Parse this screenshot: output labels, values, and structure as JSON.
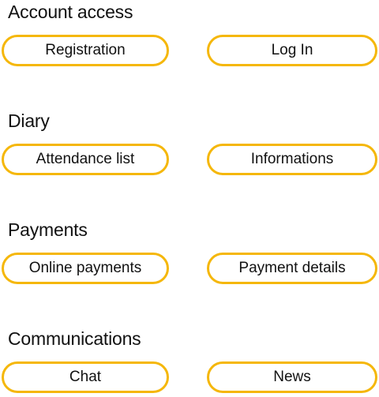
{
  "sections": [
    {
      "title": "Account access",
      "buttons": [
        "Registration",
        "Log In"
      ]
    },
    {
      "title": "Diary",
      "buttons": [
        "Attendance list",
        "Informations"
      ]
    },
    {
      "title": "Payments",
      "buttons": [
        "Online payments",
        "Payment details"
      ]
    },
    {
      "title": "Communications",
      "buttons": [
        "Chat",
        "News"
      ]
    }
  ],
  "colors": {
    "accent": "#f5b70a",
    "text": "#111111",
    "background": "#ffffff"
  }
}
